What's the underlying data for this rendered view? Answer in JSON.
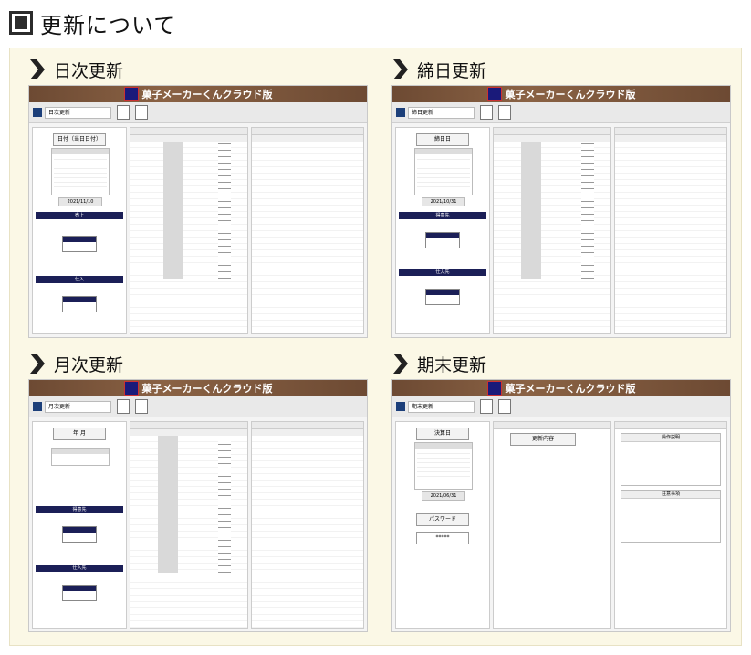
{
  "page": {
    "title": "更新について"
  },
  "sections": [
    {
      "key": "daily",
      "label": "日次更新",
      "app_banner": "菓子メーカーくんクラウド版",
      "window_title": "日次更新"
    },
    {
      "key": "closing",
      "label": "締日更新",
      "app_banner": "菓子メーカーくんクラウド版",
      "window_title": "締日更新"
    },
    {
      "key": "monthly",
      "label": "月次更新",
      "app_banner": "菓子メーカーくんクラウド版",
      "window_title": "月次更新"
    },
    {
      "key": "period",
      "label": "期末更新",
      "app_banner": "菓子メーカーくんクラウド版",
      "window_title": "期末更新"
    }
  ],
  "details": {
    "daily": {
      "param_title": "日付（当日日付）",
      "date": "2021/11/10",
      "bar1": "売上",
      "bar2": "仕入"
    },
    "closing": {
      "param_title": "締日日",
      "date": "2021/10/31",
      "bar1": "得意先",
      "bar2": "仕入先"
    },
    "monthly": {
      "param_title": "年 月",
      "date": "",
      "bar1": "得意先",
      "bar2": "仕入先"
    },
    "period": {
      "param_title": "決算日",
      "date": "2021/06/31",
      "sub_title": "更新内容",
      "password_label": "パスワード",
      "password_value": "*****",
      "info1": "操作説明",
      "info2": "注意事項"
    }
  },
  "colors": {
    "banner": "#6d4a33",
    "navy": "#1b1f57",
    "panel": "#fbf8e6"
  }
}
